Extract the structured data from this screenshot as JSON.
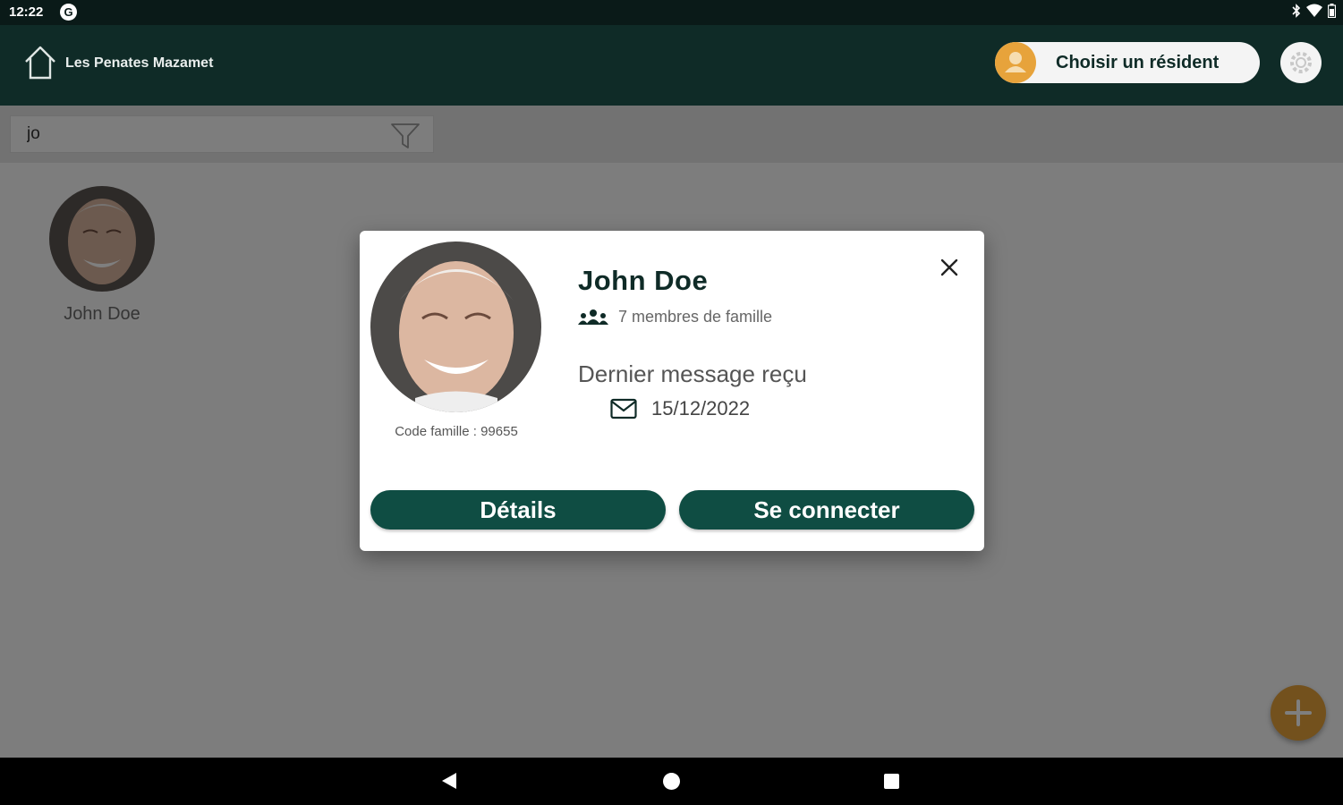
{
  "status_bar": {
    "time": "12:22",
    "app_icon_glyph": "G"
  },
  "app_bar": {
    "facility_name": "Les Penates Mazamet",
    "choose_resident_label": "Choisir un résident",
    "accent_color": "#e7a33b",
    "primary_color": "#0f2b27"
  },
  "search": {
    "value": "jo",
    "placeholder": ""
  },
  "residents": [
    {
      "name": "John Doe"
    }
  ],
  "modal": {
    "name": "John Doe",
    "family_members": "7 membres de famille",
    "family_code": "Code famille : 99655",
    "last_message_label": "Dernier message reçu",
    "last_message_date": "15/12/2022",
    "details_button": "Détails",
    "connect_button": "Se connecter",
    "button_color": "#0f4d43"
  },
  "icons": {
    "home": "home-icon",
    "filter": "filter-icon",
    "settings": "gear-icon",
    "add": "plus-icon",
    "close": "close-icon",
    "family": "people-icon",
    "mail": "envelope-icon"
  }
}
